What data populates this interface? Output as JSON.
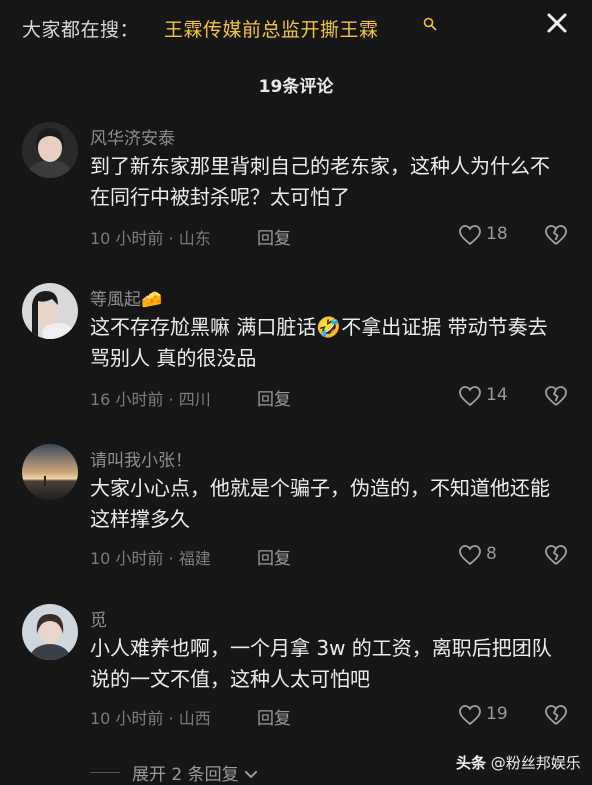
{
  "search": {
    "prefix": "大家都在搜：",
    "query": "王霖传媒前总监开撕王霖"
  },
  "comment_count": "19条评论",
  "comments": [
    {
      "author": "风华济安泰",
      "text": "到了新东家那里背刺自己的老东家，这种人为什么不在同行中被封杀呢？太可怕了",
      "meta": "10 小时前 · 山东",
      "reply": "回复",
      "likes": "18"
    },
    {
      "author": "等風起",
      "author_emoji": "🧀",
      "text": "这不存存尬黑嘛 满口脏话🤣不拿出证据 带动节奏去骂别人 真的很没品",
      "meta": "16 小时前 · 四川",
      "reply": "回复",
      "likes": "14"
    },
    {
      "author": "请叫我小张！",
      "text": "大家小心点，他就是个骗子，伪造的，不知道他还能这样撑多久",
      "meta": "10 小时前 · 福建",
      "reply": "回复",
      "likes": "8"
    },
    {
      "author": "觅",
      "text": "小人难养也啊，一个月拿 3w 的工资，离职后把团队说的一文不值，这种人太可怕吧",
      "meta": "10 小时前 · 山西",
      "reply": "回复",
      "likes": "19"
    }
  ],
  "expand_label": "展开 2 条回复",
  "watermark": {
    "brand": "头条",
    "handle": "@粉丝邦娱乐"
  },
  "colors": {
    "background": "#161616",
    "search_highlight": "#f2c531"
  }
}
